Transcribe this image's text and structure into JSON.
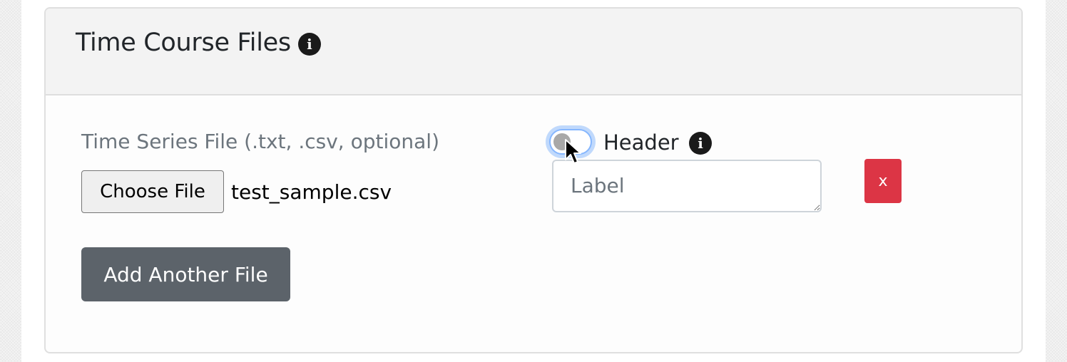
{
  "card": {
    "title": "Time Course Files",
    "title_info_icon": "info-icon"
  },
  "file_row": {
    "label": "Time Series File (.txt, .csv, optional)",
    "choose_button": "Choose File",
    "file_name": "test_sample.csv",
    "header_toggle": {
      "label": "Header",
      "checked": false,
      "icon": "info-icon"
    },
    "label_input": {
      "placeholder": "Label",
      "value": ""
    },
    "remove_button": "x"
  },
  "actions": {
    "add_file_button": "Add Another File"
  },
  "colors": {
    "remove_button": "#dc3545",
    "add_button": "#5c636a",
    "switch_focus": "#86b7fe"
  }
}
